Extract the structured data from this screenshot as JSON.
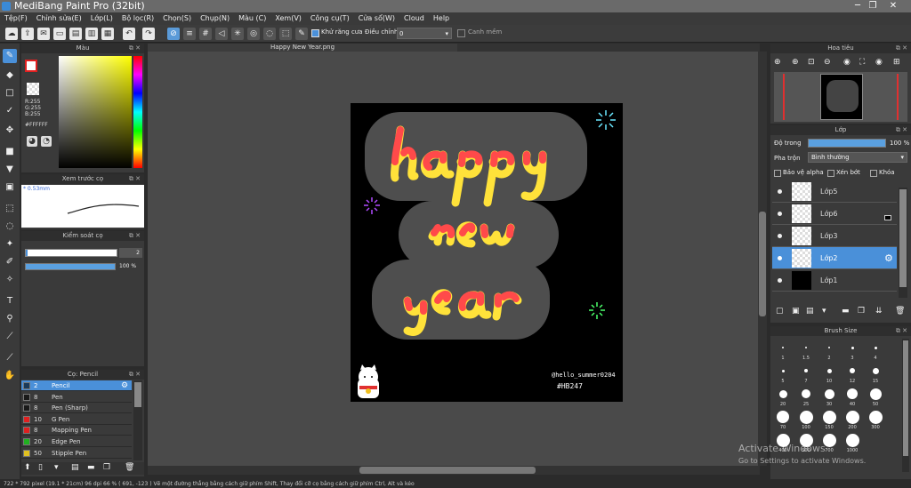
{
  "window": {
    "title": "MediBang Paint Pro (32bit)"
  },
  "menu": [
    "Tệp(F)",
    "Chỉnh sửa(E)",
    "Lớp(L)",
    "Bộ lọc(R)",
    "Chọn(S)",
    "Chụp(N)",
    "Màu (C)",
    "Xem(V)",
    "Công cụ(T)",
    "Cửa sổ(W)",
    "Cloud",
    "Help"
  ],
  "toolbar": {
    "antialias_label": "Khử răng cưa",
    "adjust_label": "Điều chỉnh",
    "adjust_value": "0",
    "smooth_label": "Canh mềm"
  },
  "color_panel": {
    "title": "Màu",
    "r": "R:255",
    "g": "G:255",
    "b": "B:255",
    "hex": "#FFFFFF"
  },
  "preview_panel": {
    "title": "Xem trước cọ",
    "size": "* 0.53mm"
  },
  "brush_control": {
    "title": "Kiểm soát cọ",
    "size_value": "2",
    "opacity_value": "100 %",
    "opacity": 1.0
  },
  "brush_panel": {
    "title": "Cọ: Pencil",
    "items": [
      {
        "size": "2",
        "name": "Pencil",
        "color": "#1a3a5a"
      },
      {
        "size": "8",
        "name": "Pen",
        "color": "#1a1a1a"
      },
      {
        "size": "8",
        "name": "Pen (Sharp)",
        "color": "#1a1a1a"
      },
      {
        "size": "10",
        "name": "G Pen",
        "color": "#e02020"
      },
      {
        "size": "8",
        "name": "Mapping Pen",
        "color": "#e02020"
      },
      {
        "size": "20",
        "name": "Edge Pen",
        "color": "#20b020"
      },
      {
        "size": "50",
        "name": "Stipple Pen",
        "color": "#e0c020"
      }
    ]
  },
  "canvas": {
    "tab_title": "Happy New Year.png",
    "watermark_line1": "@hello_summer0204",
    "watermark_line2": "#HB247"
  },
  "navigator": {
    "title": "Hoa tiêu"
  },
  "layer_panel": {
    "title": "Lớp",
    "opacity_label": "Độ trong",
    "opacity_value": "100 %",
    "opacity": 1.0,
    "blend_label": "Pha trộn",
    "blend_value": "Bình thường",
    "protect_alpha": "Bảo vệ alpha",
    "clip": "Xén bớt",
    "lock": "Khóa",
    "layers": [
      "Lớp5",
      "Lớp6",
      "Lớp3",
      "Lớp2",
      "Lớp1"
    ]
  },
  "brush_size_panel": {
    "title": "Brush Size",
    "sizes": [
      "1",
      "1.5",
      "2",
      "3",
      "4",
      "5",
      "7",
      "10",
      "12",
      "15",
      "20",
      "25",
      "30",
      "40",
      "50",
      "70",
      "100",
      "150",
      "200",
      "300",
      "400",
      "500",
      "700",
      "1000"
    ]
  },
  "os_watermark": {
    "line1": "Activate Windows",
    "line2": "Go to Settings to activate Windows."
  },
  "status": {
    "text": "722 * 792 pixel  (19.1 * 21cm)  96 dpi  66 %  ( 691, -123 )  Vẽ một đường thẳng bằng cách giữ phím Shift, Thay đổi cỡ cọ bằng cách giữ phím Ctrl, Alt và kéo"
  },
  "colors": {
    "accent": "#4a90d9",
    "bg": "#3a3a3a",
    "titlebar": "#6a6a6a"
  }
}
